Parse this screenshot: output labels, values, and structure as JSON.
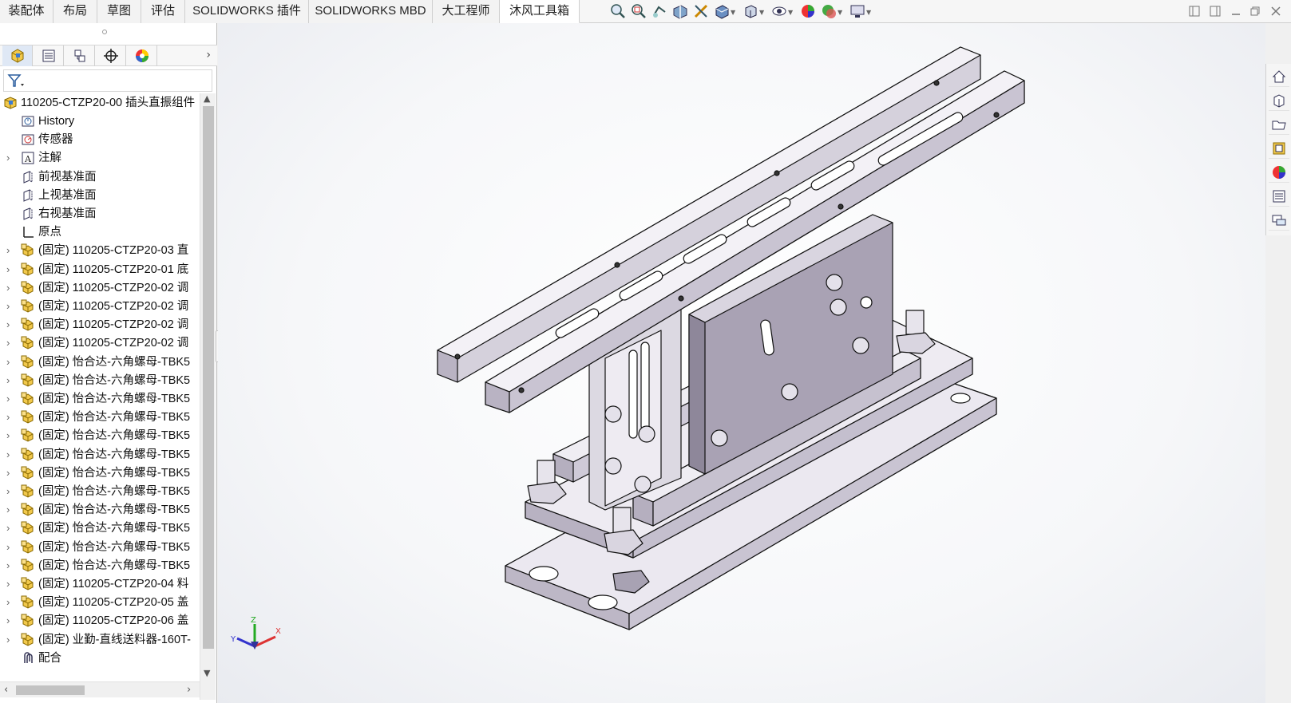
{
  "tabs": [
    "装配体",
    "布局",
    "草图",
    "评估",
    "SOLIDWORKS 插件",
    "SOLIDWORKS MBD",
    "大工程师",
    "沐风工具箱"
  ],
  "active_tab": "沐风工具箱",
  "view_toolbar_icons": [
    "zoom-to-fit-icon",
    "zoom-area-icon",
    "previous-view-icon",
    "section-view-icon",
    "dynamic-annotation-icon",
    "view-orientation-icon",
    "display-style-icon",
    "hide-show-items-icon",
    "edit-appearance-icon",
    "apply-scene-icon",
    "view-settings-icon"
  ],
  "panel_tabs": [
    "featuremanager-icon",
    "propertymanager-icon",
    "configurationmanager-icon",
    "dimxpert-icon",
    "display-manager-icon"
  ],
  "tree": {
    "root": "110205-CTZP20-00 插头直振组件",
    "items": [
      {
        "label": "History",
        "icon": "history-icon",
        "expand": false
      },
      {
        "label": "传感器",
        "icon": "sensor-icon",
        "expand": false
      },
      {
        "label": "注解",
        "icon": "annotation-icon",
        "expand": true
      },
      {
        "label": "前视基准面",
        "icon": "plane-icon",
        "expand": false
      },
      {
        "label": "上视基准面",
        "icon": "plane-icon",
        "expand": false
      },
      {
        "label": "右视基准面",
        "icon": "plane-icon",
        "expand": false
      },
      {
        "label": "原点",
        "icon": "origin-icon",
        "expand": false
      },
      {
        "label": "(固定) 110205-CTZP20-03 直",
        "icon": "part-icon",
        "expand": true
      },
      {
        "label": "(固定) 110205-CTZP20-01 底",
        "icon": "part-icon",
        "expand": true
      },
      {
        "label": "(固定) 110205-CTZP20-02 调",
        "icon": "part-icon",
        "expand": true
      },
      {
        "label": "(固定) 110205-CTZP20-02 调",
        "icon": "part-icon",
        "expand": true
      },
      {
        "label": "(固定) 110205-CTZP20-02 调",
        "icon": "part-icon",
        "expand": true
      },
      {
        "label": "(固定) 110205-CTZP20-02 调",
        "icon": "part-icon",
        "expand": true
      },
      {
        "label": "(固定) 怡合达-六角螺母-TBK5",
        "icon": "part-icon",
        "expand": true
      },
      {
        "label": "(固定) 怡合达-六角螺母-TBK5",
        "icon": "part-icon",
        "expand": true
      },
      {
        "label": "(固定) 怡合达-六角螺母-TBK5",
        "icon": "part-icon",
        "expand": true
      },
      {
        "label": "(固定) 怡合达-六角螺母-TBK5",
        "icon": "part-icon",
        "expand": true
      },
      {
        "label": "(固定) 怡合达-六角螺母-TBK5",
        "icon": "part-icon",
        "expand": true
      },
      {
        "label": "(固定) 怡合达-六角螺母-TBK5",
        "icon": "part-icon",
        "expand": true
      },
      {
        "label": "(固定) 怡合达-六角螺母-TBK5",
        "icon": "part-icon",
        "expand": true
      },
      {
        "label": "(固定) 怡合达-六角螺母-TBK5",
        "icon": "part-icon",
        "expand": true
      },
      {
        "label": "(固定) 怡合达-六角螺母-TBK5",
        "icon": "part-icon",
        "expand": true
      },
      {
        "label": "(固定) 怡合达-六角螺母-TBK5",
        "icon": "part-icon",
        "expand": true
      },
      {
        "label": "(固定) 怡合达-六角螺母-TBK5",
        "icon": "part-icon",
        "expand": true
      },
      {
        "label": "(固定) 怡合达-六角螺母-TBK5",
        "icon": "part-icon",
        "expand": true
      },
      {
        "label": "(固定) 110205-CTZP20-04 料",
        "icon": "part-icon",
        "expand": true
      },
      {
        "label": "(固定) 110205-CTZP20-05 盖",
        "icon": "part-icon",
        "expand": true
      },
      {
        "label": "(固定) 110205-CTZP20-06 盖",
        "icon": "part-icon",
        "expand": true
      },
      {
        "label": "(固定) 业勤-直线送料器-160T-",
        "icon": "part-icon",
        "expand": true
      },
      {
        "label": "配合",
        "icon": "mates-icon",
        "expand": false
      }
    ]
  },
  "triad": {
    "x": "X",
    "y": "Y",
    "z": "Z"
  },
  "taskpane_icons": [
    "solidworks-resources-icon",
    "design-library-icon",
    "file-explorer-icon",
    "view-palette-icon",
    "appearances-icon",
    "custom-properties-icon",
    "solidworks-forum-icon"
  ],
  "colors": {
    "model_face": "#c9c4d2",
    "model_dark": "#a59eb0",
    "model_light": "#e9e6ee",
    "edge": "#111111"
  }
}
